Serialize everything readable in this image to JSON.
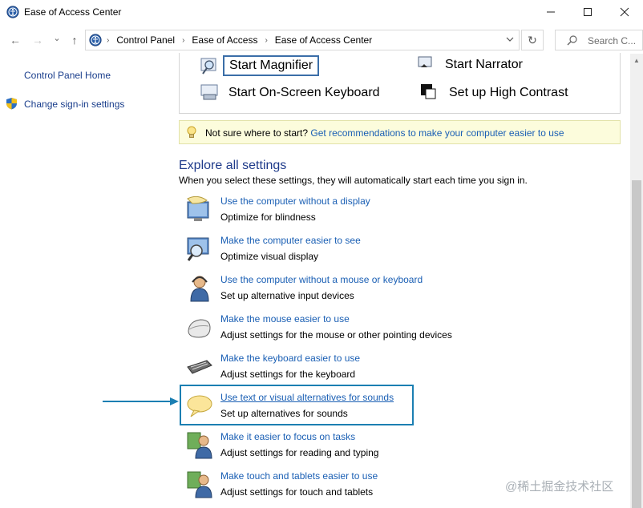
{
  "window": {
    "title": "Ease of Access Center",
    "controls": {
      "minimize": "—",
      "maximize": "☐",
      "close": "✕"
    }
  },
  "nav": {
    "back": "←",
    "forward": "→",
    "recent": "⌄",
    "up": "↑",
    "breadcrumb": [
      "Control Panel",
      "Ease of Access",
      "Ease of Access Center"
    ],
    "refresh": "↻",
    "search_placeholder": "Search C..."
  },
  "sidebar": {
    "items": [
      {
        "label": "Control Panel Home"
      },
      {
        "label": "Change sign-in settings"
      }
    ]
  },
  "quick_access": {
    "items": [
      {
        "label": "Start Magnifier",
        "icon": "magnifier-icon"
      },
      {
        "label": "Start Narrator",
        "icon": "narrator-icon"
      },
      {
        "label": "Start On-Screen Keyboard",
        "icon": "keyboard-icon"
      },
      {
        "label": "Set up High Contrast",
        "icon": "contrast-icon"
      }
    ]
  },
  "tip": {
    "text": "Not sure where to start?",
    "link": "Get recommendations to make your computer easier to use"
  },
  "explore": {
    "heading": "Explore all settings",
    "subheading": "When you select these settings, they will automatically start each time you sign in.",
    "settings": [
      {
        "link": "Use the computer without a display",
        "desc": "Optimize for blindness",
        "icon": "monitor-speech-icon"
      },
      {
        "link": "Make the computer easier to see",
        "desc": "Optimize visual display",
        "icon": "monitor-magnifier-icon"
      },
      {
        "link": "Use the computer without a mouse or keyboard",
        "desc": "Set up alternative input devices",
        "icon": "person-headset-icon"
      },
      {
        "link": "Make the mouse easier to use",
        "desc": "Adjust settings for the mouse or other pointing devices",
        "icon": "mouse-icon"
      },
      {
        "link": "Make the keyboard easier to use",
        "desc": "Adjust settings for the keyboard",
        "icon": "keyboard-icon"
      },
      {
        "link": "Use text or visual alternatives for sounds",
        "desc": "Set up alternatives for sounds",
        "icon": "speech-bubble-icon"
      },
      {
        "link": "Make it easier to focus on tasks",
        "desc": "Adjust settings for reading and typing",
        "icon": "people-icon"
      },
      {
        "link": "Make touch and tablets easier to use",
        "desc": "Adjust settings for touch and tablets",
        "icon": "people-icon"
      }
    ]
  },
  "watermark": "@稀土掘金技术社区",
  "colors": {
    "link": "#1a5fb4",
    "highlight": "#1b7fb2",
    "tip_bg": "#fcfcdc"
  }
}
